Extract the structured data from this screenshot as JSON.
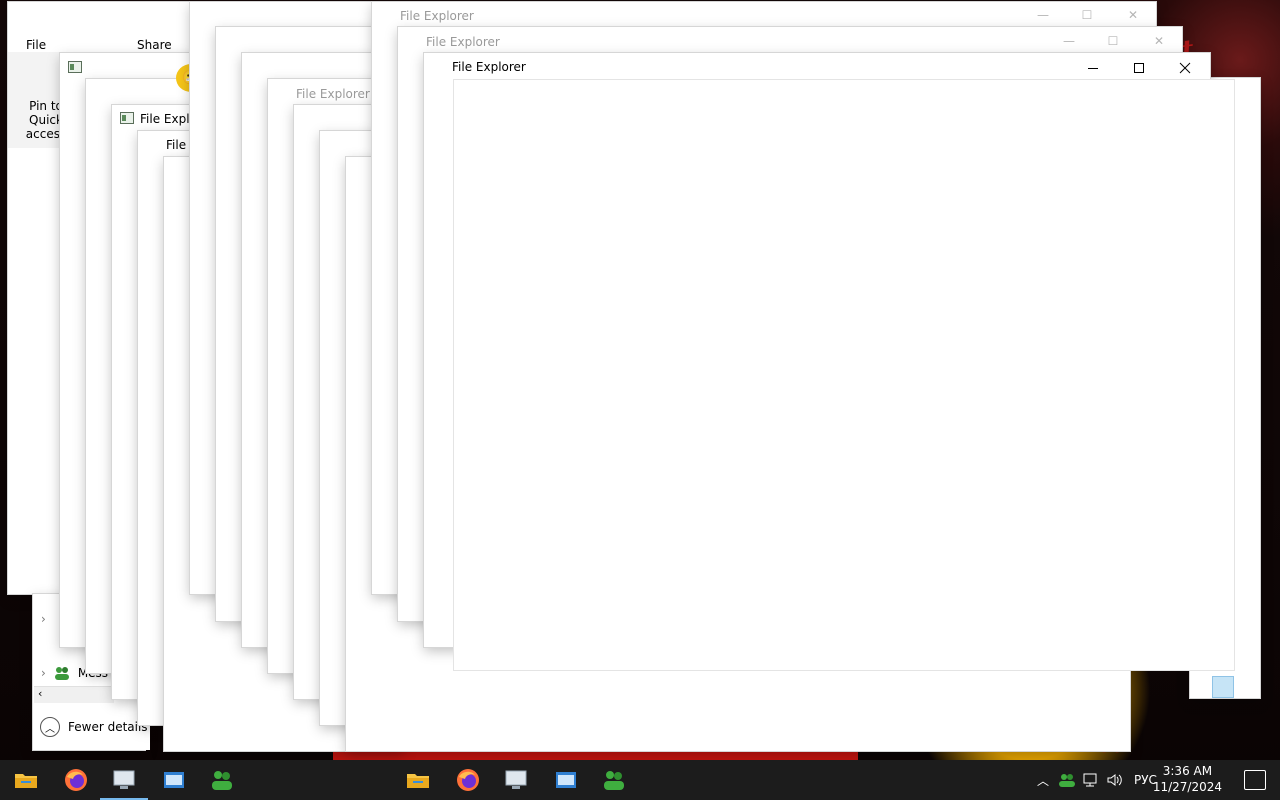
{
  "window_title": "File Explorer",
  "ghost_titles": {
    "w1": "File Explorer",
    "w2": "File Explorer",
    "w3": "File Explorer",
    "w4": "File Explo",
    "w5": "File E"
  },
  "ribbon": {
    "file_tab": "File",
    "share_tab": "Share",
    "pin_label": "Pin to Quick access"
  },
  "nav": {
    "messenger_item": "Mess",
    "fewer_details": "Fewer details"
  },
  "taskbar": {
    "language": "РУС",
    "time": "3:36 AM",
    "date": "11/27/2024"
  },
  "icons": {
    "file_explorer": "folder-icon",
    "firefox": "firefox-icon",
    "remote": "computer-icon",
    "app": "window-app-icon",
    "users": "users-icon"
  }
}
